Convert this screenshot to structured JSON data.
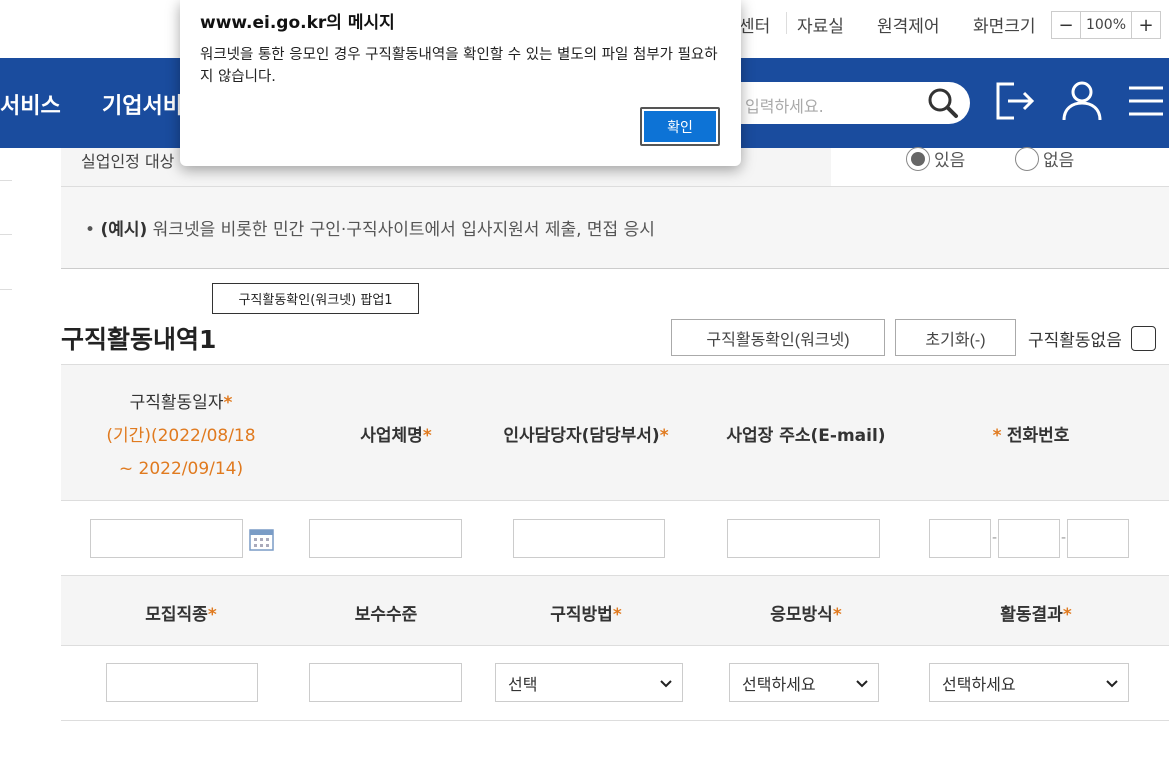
{
  "topbar": {
    "links": [
      "센터",
      "자료실",
      "원격제어",
      "화면크기"
    ],
    "zoom": {
      "minus": "−",
      "value": "100%",
      "plus": "+"
    }
  },
  "nav": {
    "items": [
      "서비스",
      "기업서비"
    ],
    "search_placeholder": "입력하세요."
  },
  "unemployment": {
    "label": "실업인정 대상",
    "option_yes": "있음",
    "option_no": "없음",
    "selected": "있음"
  },
  "example": {
    "prefix": "(예시)",
    "text": "워크넷을 비롯한 민간 구인·구직사이트에서 입사지원서 제출, 면접 응시"
  },
  "tooltip": "구직활동확인(워크넷) 팝업1",
  "section": {
    "title": "구직활동내역1",
    "btn_confirm": "구직활동확인(워크넷)",
    "btn_reset": "초기화(-)",
    "no_activity_label": "구직활동없음"
  },
  "table1": {
    "col_date": "구직활동일자",
    "date_range_line1": "(기간)(2022/08/18",
    "date_range_line2": "~ 2022/09/14)",
    "col_company": "사업체명",
    "col_hr": "인사담당자(담당부서)",
    "col_address": "사업장 주소(E-mail)",
    "col_phone": "전화번호",
    "req_mark": "*",
    "phone_sep": "-"
  },
  "table2": {
    "col_job": "모집직종",
    "col_pay": "보수수준",
    "col_method": "구직방법",
    "col_apply": "응모방식",
    "col_result": "활동결과",
    "method_value": "선택",
    "apply_value": "선택하세요",
    "result_value": "선택하세요"
  },
  "dialog": {
    "title": "www.ei.go.kr의 메시지",
    "message": "워크넷을 통한 응모인 경우 구직활동내역을 확인할 수 있는 별도의 파일 첨부가 필요하지 않습니다.",
    "ok_label": "확인"
  },
  "colors": {
    "nav_blue": "#1a4c9e",
    "accent_orange": "#e07a1f",
    "ok_blue": "#0d73d6"
  }
}
